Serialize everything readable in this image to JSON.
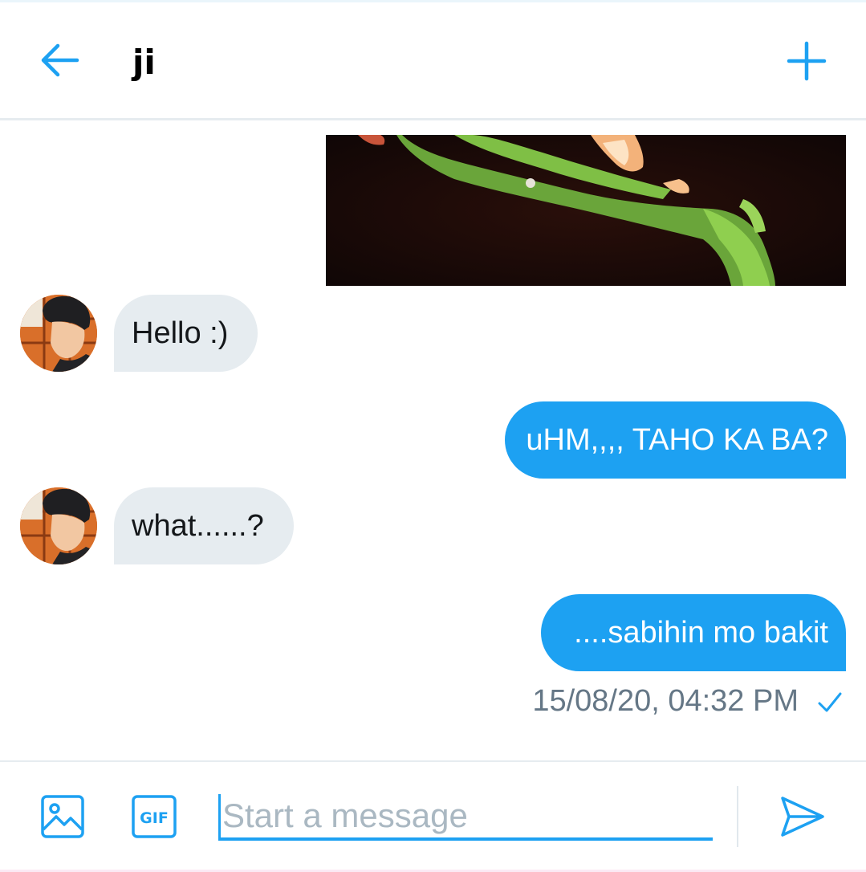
{
  "header": {
    "title": "ji",
    "back_icon": "arrow-left-icon",
    "add_icon": "plus-icon"
  },
  "conversation": {
    "media": {
      "icon": "image-icon"
    },
    "messages": [
      {
        "direction": "incoming",
        "text": "Hello :)"
      },
      {
        "direction": "outgoing",
        "text": "uHM,,,, TAHO KA BA?"
      },
      {
        "direction": "incoming",
        "text": "what......?"
      },
      {
        "direction": "outgoing",
        "text": "....sabihin mo bakit"
      }
    ],
    "timestamp": "15/08/20, 04:32 PM",
    "status_icon": "checkmark-icon"
  },
  "composer": {
    "placeholder": "Start a message",
    "value": "",
    "image_icon": "image-icon",
    "gif_icon": "gif-icon",
    "gif_label": "GIF",
    "send_icon": "send-icon"
  },
  "colors": {
    "accent": "#1da1f2",
    "incoming_bubble": "#e6ecf0",
    "timestamp_text": "#657786",
    "placeholder_text": "#aab8c2"
  }
}
